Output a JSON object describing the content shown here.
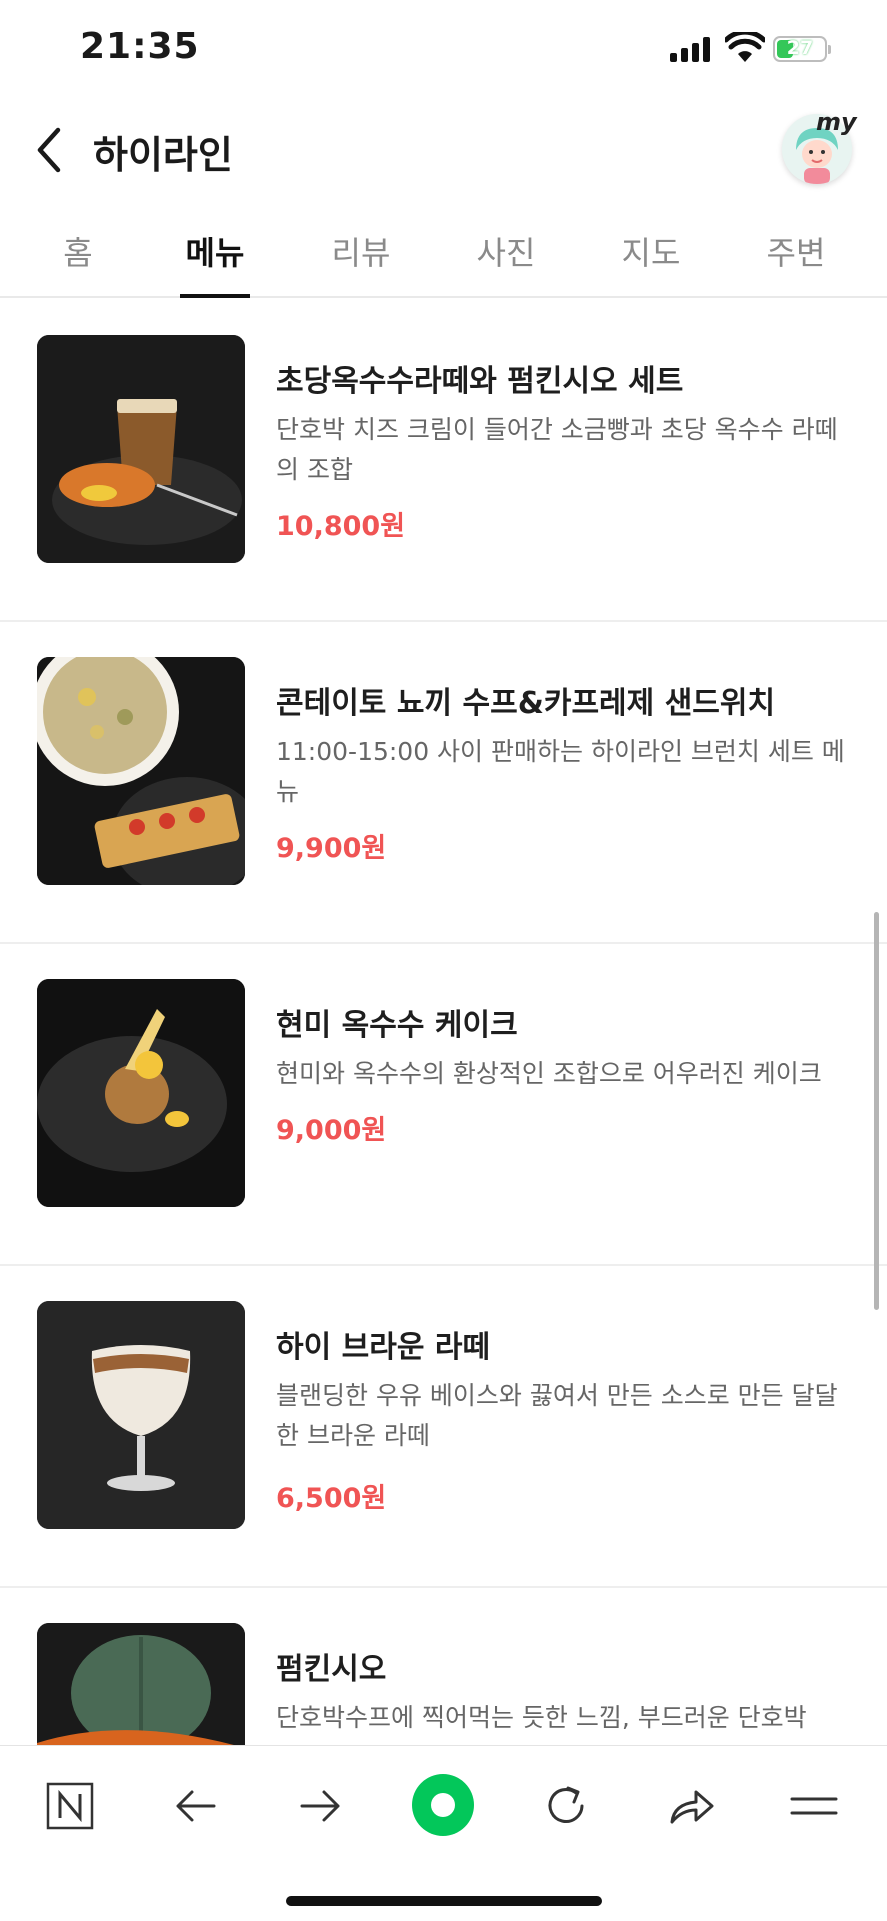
{
  "status_bar": {
    "time": "21:35",
    "battery_label": "27"
  },
  "header": {
    "title": "하이라인",
    "profile_tag": "my"
  },
  "tabs": [
    {
      "label": "홈"
    },
    {
      "label": "메뉴"
    },
    {
      "label": "리뷰"
    },
    {
      "label": "사진"
    },
    {
      "label": "지도"
    },
    {
      "label": "주변"
    }
  ],
  "active_tab": "메뉴",
  "menu": [
    {
      "name": "초당옥수수라떼와 펌킨시오 세트",
      "description": "단호박 치즈 크림이 들어간 소금빵과 초당 옥수수 라떼의 조합",
      "price": "10,800원"
    },
    {
      "name": "콘테이토 뇨끼 수프&카프레제 샌드위치",
      "description": "11:00-15:00 사이 판매하는 하이라인 브런치 세트 메뉴",
      "price": "9,900원"
    },
    {
      "name": "현미 옥수수 케이크",
      "description": "현미와 옥수수의 환상적인 조합으로 어우러진 케이크",
      "price": "9,000원"
    },
    {
      "name": "하이 브라운 라떼",
      "description": "블랜딩한 우유 베이스와 끓여서 만든 소스로 만든 달달한 브라운 라떼",
      "price": "6,500원"
    },
    {
      "name": "펌킨시오",
      "description": "단호박수프에 찍어먹는 듯한 느낌, 부드러운 단호박",
      "price": ""
    }
  ],
  "colors": {
    "price": "#f05454",
    "naver_green": "#03c75a",
    "battery": "#34c759"
  },
  "toolbar_icons": [
    "naver-n-icon",
    "back-arrow-icon",
    "forward-arrow-icon",
    "naver-green-dot-icon",
    "reload-icon",
    "share-icon",
    "menu-icon"
  ]
}
